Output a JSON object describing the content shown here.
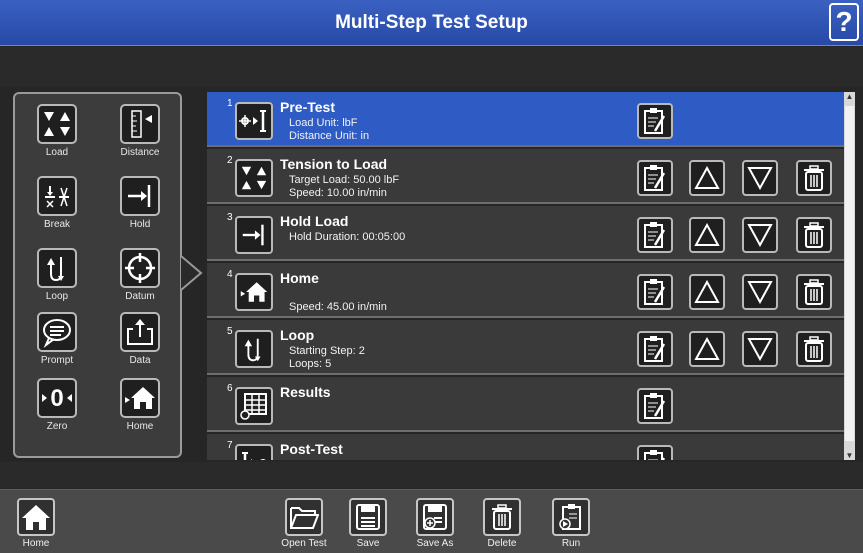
{
  "header": {
    "title": "Multi-Step Test Setup",
    "help_label": "?"
  },
  "palette": {
    "items": [
      {
        "label": "Load",
        "icon": "load-arrows-icon"
      },
      {
        "label": "Distance",
        "icon": "distance-ruler-icon"
      },
      {
        "label": "Break",
        "icon": "break-icon"
      },
      {
        "label": "Hold",
        "icon": "hold-icon"
      },
      {
        "label": "Loop",
        "icon": "loop-icon"
      },
      {
        "label": "Datum",
        "icon": "datum-crosshair-icon"
      },
      {
        "label": "Prompt",
        "icon": "prompt-speech-icon"
      },
      {
        "label": "Data",
        "icon": "data-export-icon"
      },
      {
        "label": "Zero",
        "icon": "zero-icon",
        "glyph": "0"
      },
      {
        "label": "Home",
        "icon": "home-icon"
      }
    ]
  },
  "steps": [
    {
      "num": "1",
      "name": "Pre-Test",
      "details": [
        "Load Unit: lbF",
        "Distance Unit: in"
      ],
      "icon": "pretest-icon",
      "selected": true,
      "reorder": false
    },
    {
      "num": "2",
      "name": "Tension to Load",
      "details": [
        "Target Load: 50.00 lbF",
        "Speed: 10.00 in/min"
      ],
      "icon": "load-arrows-icon",
      "selected": false,
      "reorder": true
    },
    {
      "num": "3",
      "name": "Hold Load",
      "details": [
        "Hold Duration: 00:05:00"
      ],
      "icon": "hold-icon",
      "selected": false,
      "reorder": true
    },
    {
      "num": "4",
      "name": "Home",
      "details": [
        "",
        "Speed: 45.00 in/min"
      ],
      "icon": "home-icon",
      "selected": false,
      "reorder": true
    },
    {
      "num": "5",
      "name": "Loop",
      "details": [
        "Starting Step: 2",
        "Loops: 5"
      ],
      "icon": "loop-icon",
      "selected": false,
      "reorder": true
    },
    {
      "num": "6",
      "name": "Results",
      "details": [],
      "icon": "results-table-icon",
      "selected": false,
      "reorder": false
    },
    {
      "num": "7",
      "name": "Post-Test",
      "details": [],
      "icon": "posttest-icon",
      "selected": false,
      "reorder": false
    }
  ],
  "toolbar": {
    "home_label": "Home",
    "open_label": "Open Test",
    "save_label": "Save",
    "save_as_label": "Save As",
    "delete_label": "Delete",
    "run_label": "Run"
  },
  "colors": {
    "accent": "#2f5bc5",
    "title_bar": "#3158bd",
    "background": "#262626",
    "panel": "#3a3a3a"
  }
}
